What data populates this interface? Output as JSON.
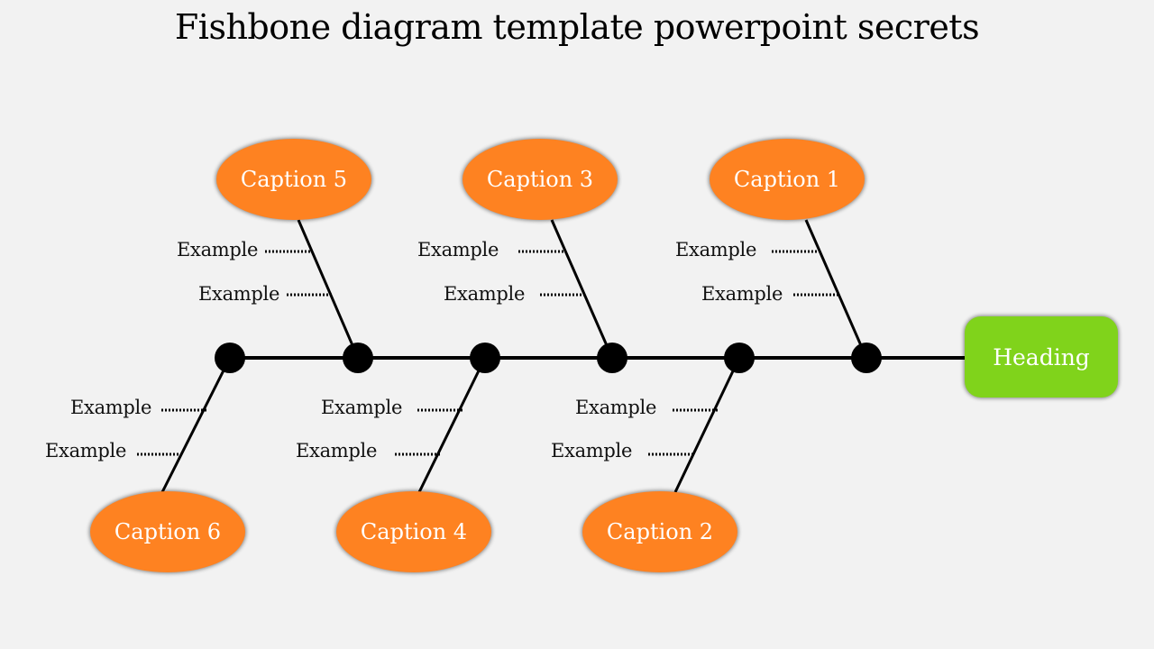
{
  "title": "Fishbone diagram template powerpoint secrets",
  "heading": "Heading",
  "captions": {
    "c1": "Caption 1",
    "c2": "Caption 2",
    "c3": "Caption 3",
    "c4": "Caption 4",
    "c5": "Caption 5",
    "c6": "Caption 6"
  },
  "examples": {
    "c5a": "Example",
    "c5b": "Example",
    "c3a": "Example",
    "c3b": "Example",
    "c1a": "Example",
    "c1b": "Example",
    "c6a": "Example",
    "c6b": "Example",
    "c4a": "Example",
    "c4b": "Example",
    "c2a": "Example",
    "c2b": "Example"
  },
  "colors": {
    "caption_fill": "#fe8221",
    "heading_fill": "#80d31b",
    "spine": "#000000",
    "background": "#f2f2f2"
  }
}
